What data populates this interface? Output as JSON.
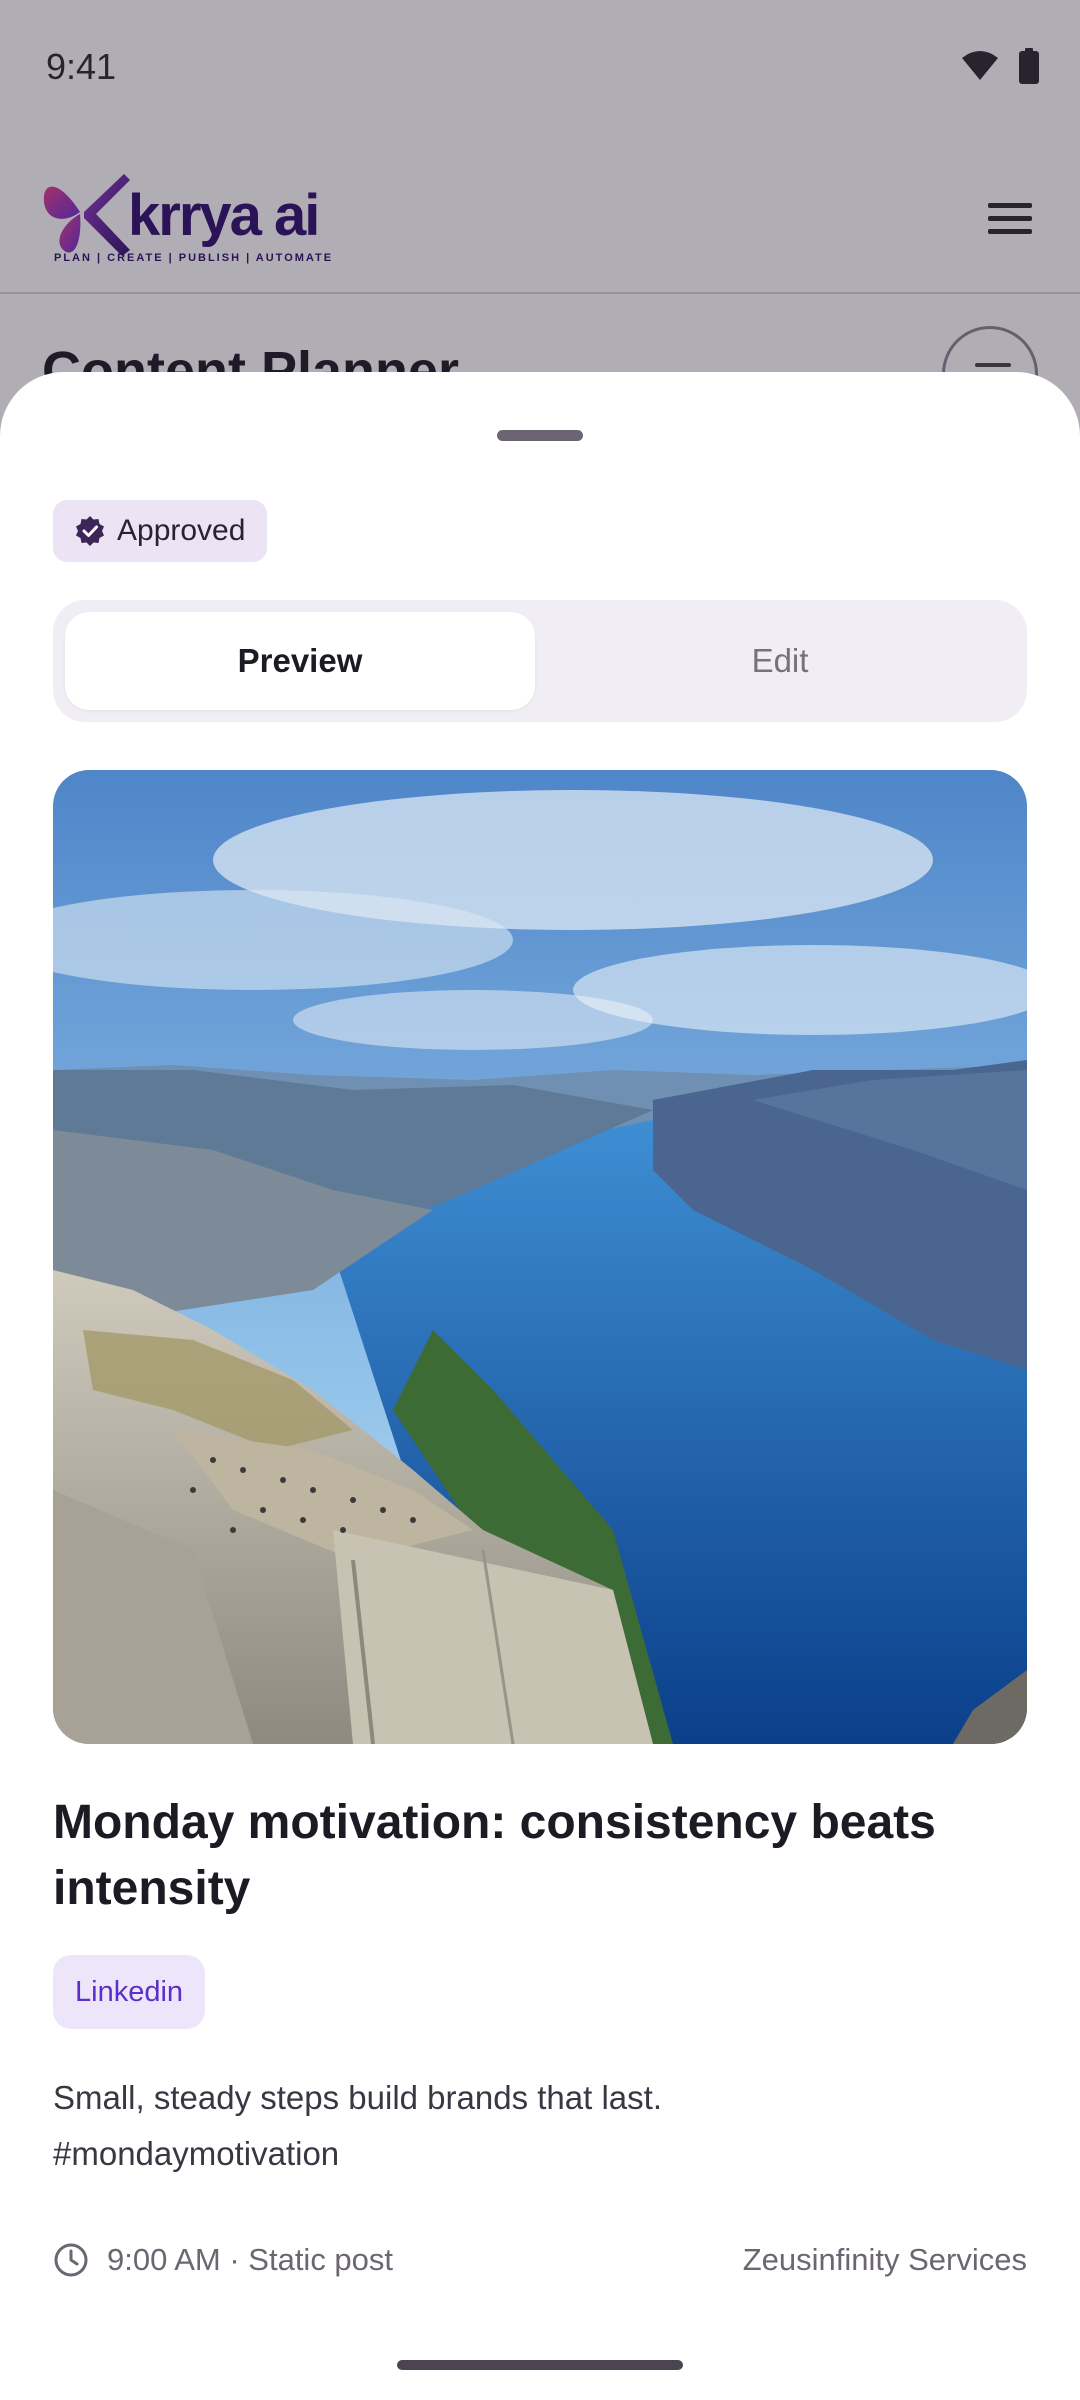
{
  "status_bar": {
    "time": "9:41",
    "icons": [
      "wifi-icon",
      "battery-icon"
    ]
  },
  "app": {
    "logo_text": "krrya ai",
    "logo_tagline": "PLAN | CREATE | PUBLISH | AUTOMATE",
    "menu_icon": "hamburger-menu-icon",
    "page_title": "Content Planner",
    "filter_icon": "filter-icon"
  },
  "sheet": {
    "status": {
      "label": "Approved",
      "icon": "verified-badge-icon"
    },
    "tabs": [
      {
        "label": "Preview",
        "selected": true
      },
      {
        "label": "Edit",
        "selected": false
      }
    ],
    "post": {
      "image_alt": "Fjord cliff landscape",
      "title": "Monday motivation: consistency beats intensity",
      "platform": "Linkedin",
      "caption": "Small, steady steps build brands that last.\n#mondaymotivation",
      "time_and_type": "9:00 AM · Static post",
      "account": "Zeusinfinity Services"
    }
  },
  "colors": {
    "accent": "#5b2fc9",
    "status_chip_bg": "#ece4f5",
    "platform_chip_bg": "#ede6fb",
    "segmented_bg": "#f1edf5"
  }
}
